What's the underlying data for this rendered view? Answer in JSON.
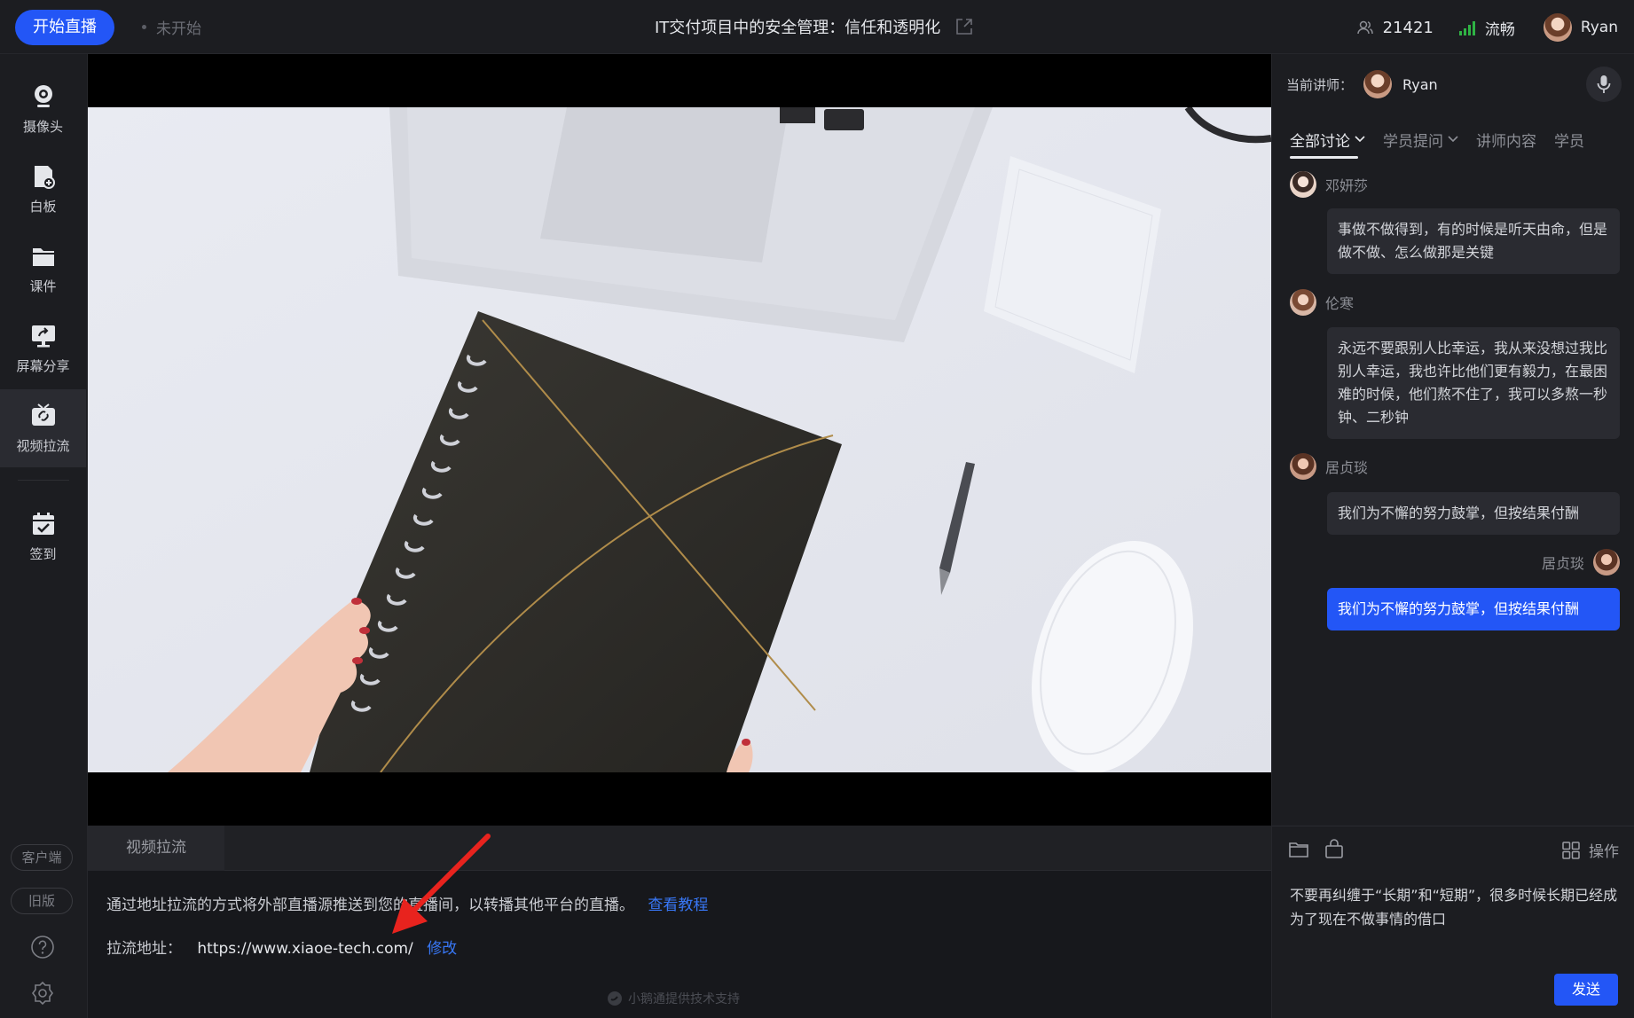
{
  "topbar": {
    "start_live_label": "开始直播",
    "status": "未开始",
    "title": "IT交付项目中的安全管理：信任和透明化",
    "viewer_count": "21421",
    "network_status": "流畅",
    "user_name": "Ryan"
  },
  "sidebar": {
    "tools": [
      {
        "label": "摄像头",
        "icon": "camera-icon"
      },
      {
        "label": "白板",
        "icon": "whiteboard-icon"
      },
      {
        "label": "课件",
        "icon": "courseware-icon"
      },
      {
        "label": "屏幕分享",
        "icon": "screen-share-icon"
      },
      {
        "label": "视频拉流",
        "icon": "video-pull-icon",
        "active": true
      },
      {
        "label": "签到",
        "icon": "checkin-icon"
      }
    ],
    "client_label": "客户端",
    "old_version_label": "旧版"
  },
  "bottom_panel": {
    "tab_label": "视频拉流",
    "description": "通过地址拉流的方式将外部直播源推送到您的直播间，以转播其他平台的直播。",
    "tutorial_link": "查看教程",
    "address_label": "拉流地址：",
    "address_value": "https://www.xiaoe-tech.com/",
    "edit_label": "修改",
    "powered_by": "小鹅通提供技术支持"
  },
  "right_panel": {
    "lecturer_label": "当前讲师：",
    "lecturer_name": "Ryan",
    "tabs": [
      {
        "label": "全部讨论",
        "has_dropdown": true,
        "active": true
      },
      {
        "label": "学员提问",
        "has_dropdown": true
      },
      {
        "label": "讲师内容"
      },
      {
        "label": "学员"
      }
    ],
    "messages": [
      {
        "name": "邓妍莎",
        "text": "事做不做得到，有的时候是听天由命，但是做不做、怎么做那是关键"
      },
      {
        "name": "伦寒",
        "text": "永远不要跟别人比幸运，我从来没想过我比别人幸运，我也许比他们更有毅力，在最困难的时候，他们熬不住了，我可以多熬一秒钟、二秒钟"
      },
      {
        "name": "居贞琰",
        "text": "我们为不懈的努力鼓掌，但按结果付酬"
      },
      {
        "name": "居贞琰",
        "text": "我们为不懈的努力鼓掌，但按结果付酬",
        "mine": true
      }
    ],
    "operations_label": "操作",
    "input_text": "不要再纠缠于“长期”和“短期”，很多时候长期已经成为了现在不做事情的借口",
    "send_label": "发送"
  },
  "colors": {
    "accent": "#2356f6",
    "link": "#3877f6",
    "background": "#16171b",
    "panel": "#1c1d21",
    "signal": "#2fb344",
    "annotation_arrow": "#e8231e"
  }
}
